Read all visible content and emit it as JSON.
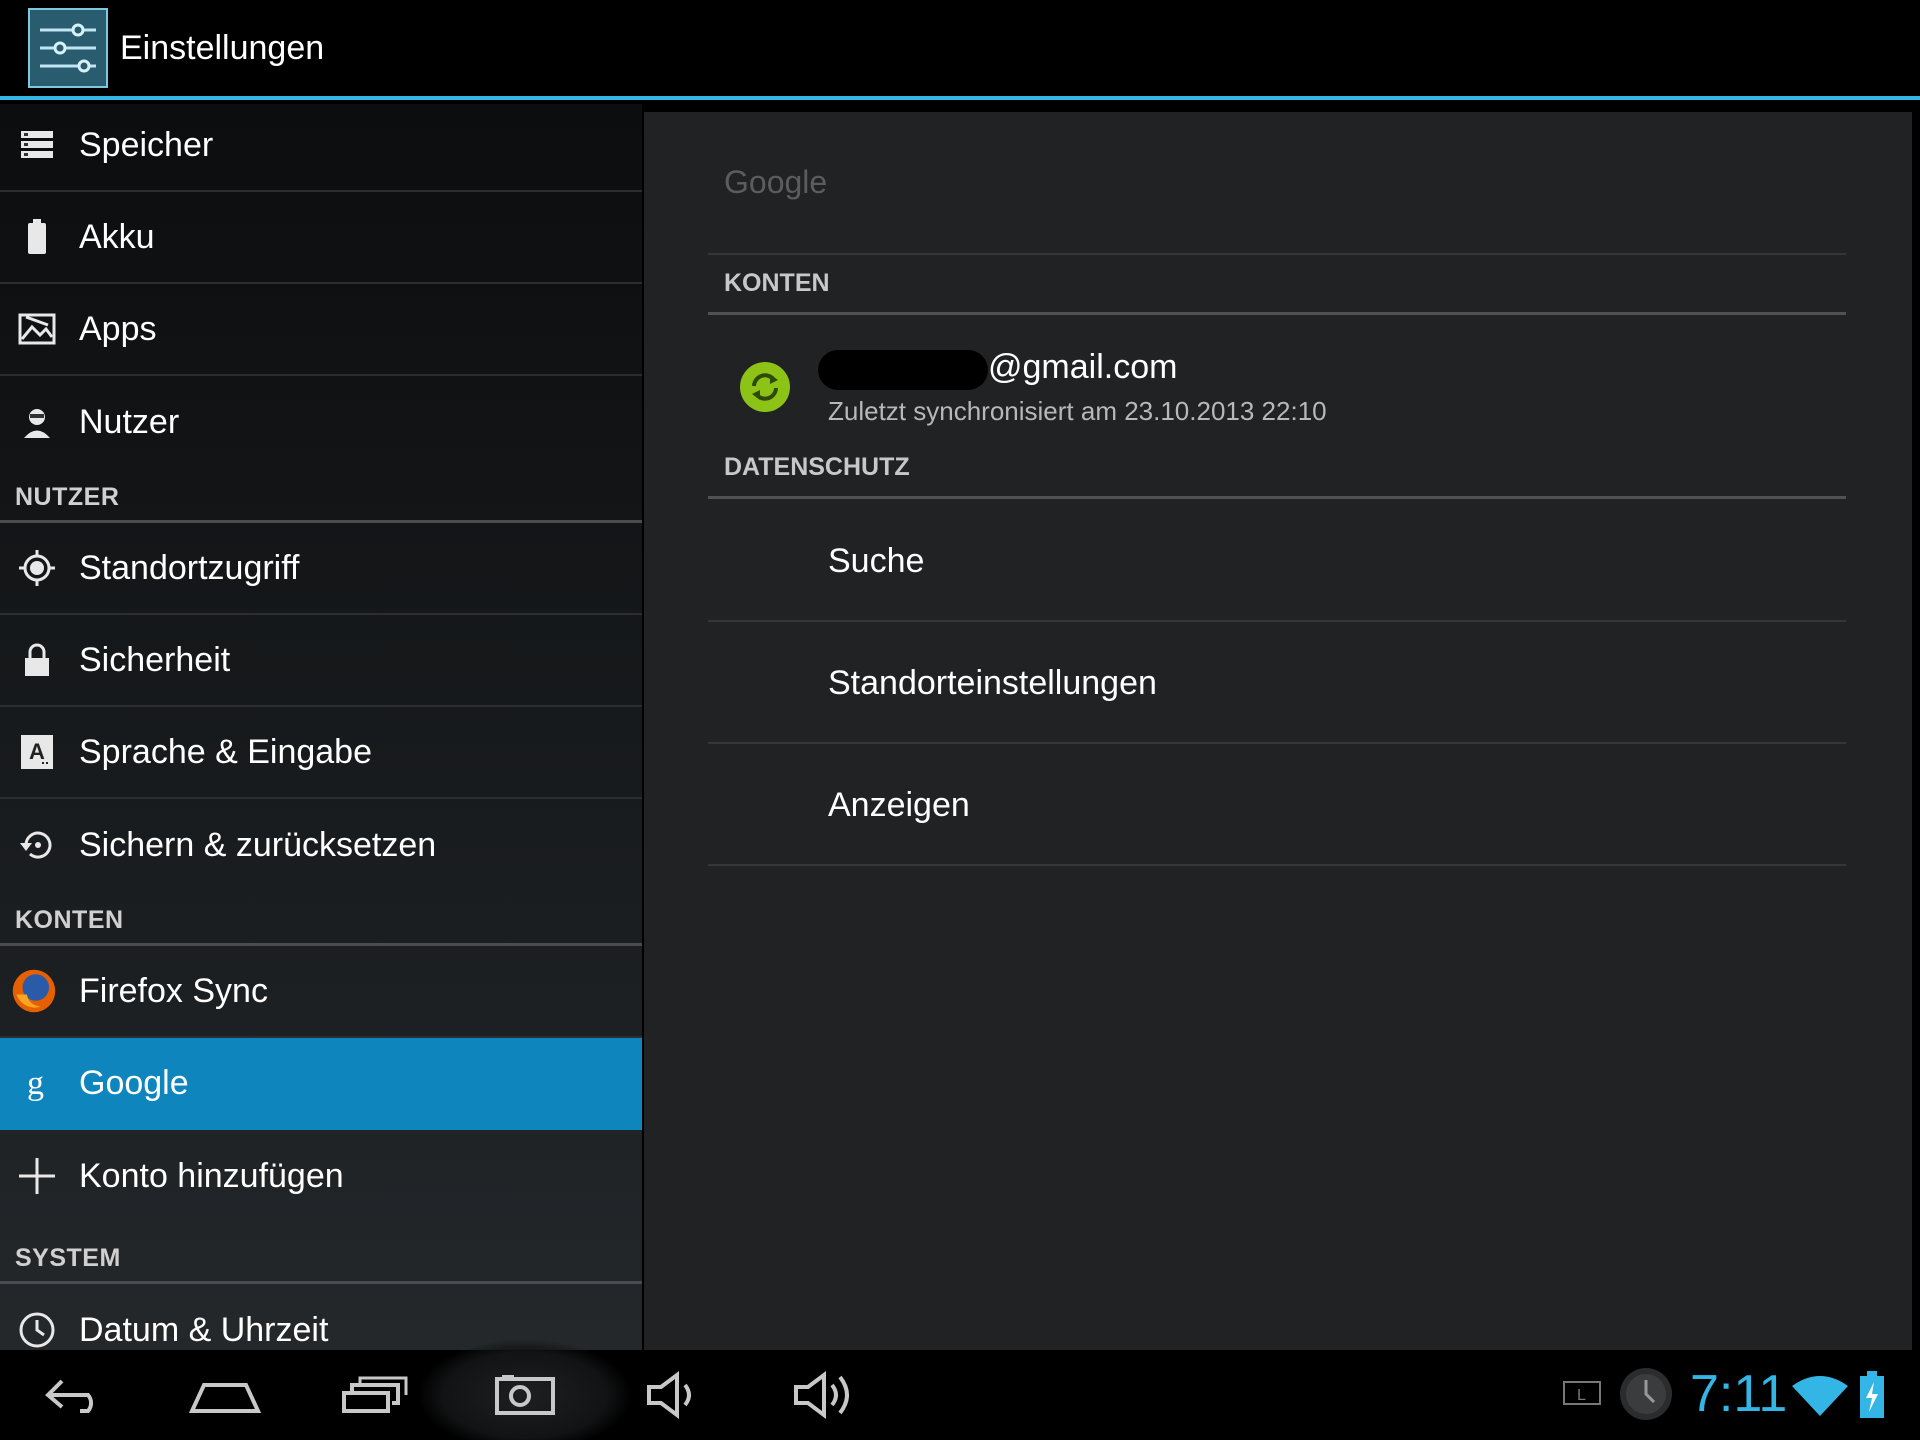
{
  "action_bar": {
    "title": "Einstellungen",
    "icon": "settings-sliders-icon"
  },
  "left_list": {
    "items_top": [
      {
        "icon": "storage-icon",
        "label": "Speicher"
      },
      {
        "icon": "battery-icon",
        "label": "Akku"
      },
      {
        "icon": "apps-icon",
        "label": "Apps"
      },
      {
        "icon": "user-icon",
        "label": "Nutzer"
      }
    ],
    "header_nutzer": "NUTZER",
    "items_nutzer": [
      {
        "icon": "location-icon",
        "label": "Standortzugriff"
      },
      {
        "icon": "lock-icon",
        "label": "Sicherheit"
      },
      {
        "icon": "language-icon",
        "label": "Sprache & Eingabe"
      },
      {
        "icon": "backup-icon",
        "label": "Sichern & zurücksetzen"
      }
    ],
    "header_konten": "KONTEN",
    "items_konten": [
      {
        "icon": "firefox-icon",
        "label": "Firefox Sync"
      },
      {
        "icon": "google-icon",
        "label": "Google",
        "selected": true
      },
      {
        "icon": "plus-icon",
        "label": "Konto hinzufügen"
      }
    ],
    "header_system": "SYSTEM",
    "items_system": [
      {
        "icon": "clock-icon",
        "label": "Datum & Uhrzeit"
      }
    ]
  },
  "detail": {
    "title": "Google",
    "konten_header": "KONTEN",
    "account": {
      "email": "@gmail.com",
      "sync_status": "Zuletzt synchronisiert am 23.10.2013 22:10",
      "icon": "sync-icon"
    },
    "datenschutz_header": "DATENSCHUTZ",
    "privacy_items": [
      "Suche",
      "Standorteinstellungen",
      "Anzeigen"
    ]
  },
  "nav_bar": {
    "buttons": [
      "back-icon",
      "home-icon",
      "recent-apps-icon",
      "screenshot-icon",
      "volume-down-icon",
      "volume-up-icon"
    ],
    "clock": "7:11",
    "status_icons": [
      "keyboard-layout-icon",
      "alarm-clock-icon",
      "wifi-icon",
      "battery-charging-icon"
    ],
    "accent_color": "#33b5e5",
    "selection_color": "#0e85bd",
    "sync_color": "#8dc217"
  }
}
